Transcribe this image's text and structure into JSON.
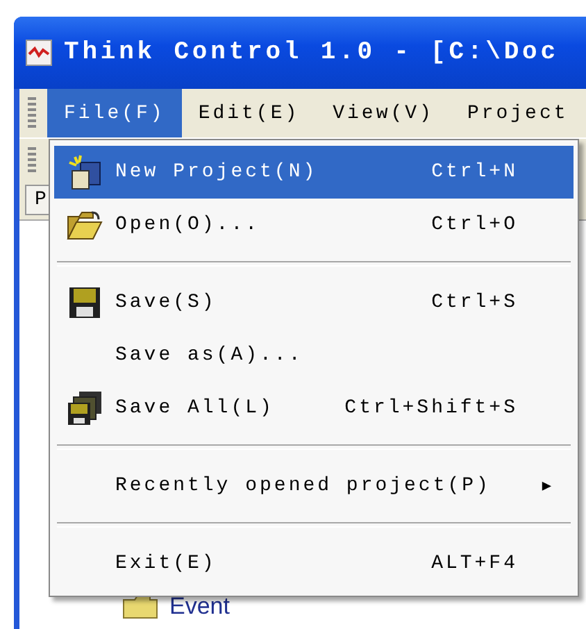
{
  "window": {
    "title": "Think Control 1.0 - [C:\\Doc"
  },
  "menu_bar": [
    {
      "label": "File(F)",
      "selected": true
    },
    {
      "label": "Edit(E)",
      "selected": false
    },
    {
      "label": "View(V)",
      "selected": false
    },
    {
      "label": "Project",
      "selected": false
    }
  ],
  "panel_tab": "P",
  "file_menu": [
    {
      "kind": "item",
      "label": "New Project(N)",
      "shortcut": "Ctrl+N",
      "selected": true
    },
    {
      "kind": "item",
      "label": "Open(O)...",
      "shortcut": "Ctrl+O",
      "selected": false
    },
    {
      "kind": "separator"
    },
    {
      "kind": "item",
      "label": "Save(S)",
      "shortcut": "Ctrl+S",
      "selected": false
    },
    {
      "kind": "item",
      "label": "Save as(A)...",
      "selected": false
    },
    {
      "kind": "item",
      "label": "Save All(L)",
      "shortcut": "Ctrl+Shift+S",
      "selected": false
    },
    {
      "kind": "separator"
    },
    {
      "kind": "submenu",
      "label": "Recently opened project(P)",
      "arrow": "▶",
      "selected": false
    },
    {
      "kind": "separator"
    },
    {
      "kind": "item",
      "label": "Exit(E)",
      "shortcut": "ALT+F4",
      "selected": false
    }
  ],
  "tree": [
    {
      "label": "Event"
    }
  ]
}
